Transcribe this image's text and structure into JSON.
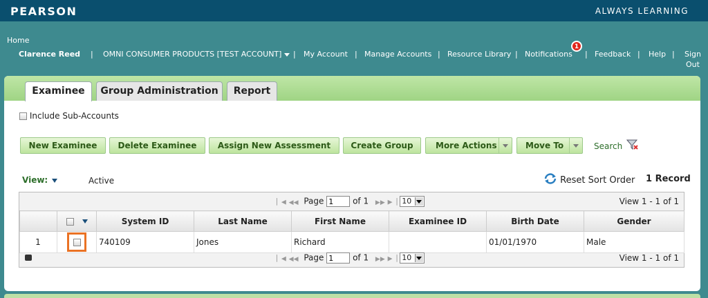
{
  "header": {
    "logo": "PEARSON",
    "tagline": "ALWAYS LEARNING"
  },
  "nav": {
    "home": "Home",
    "user": "Clarence Reed",
    "account": "OMNI CONSUMER PRODUCTS [TEST ACCOUNT]",
    "links": [
      "My Account",
      "Manage Accounts",
      "Resource Library",
      "Notifications",
      "Feedback",
      "Help"
    ],
    "sign_out_1": "Sign",
    "sign_out_2": "Out",
    "notification_count": "1",
    "separator": "|"
  },
  "tabs": [
    "Examinee",
    "Group Administration",
    "Report"
  ],
  "include_sub_accounts": "Include Sub-Accounts",
  "toolbar": {
    "new_examinee": "New Examinee",
    "delete_examinee": "Delete Examinee",
    "assign_new_assessment": "Assign New Assessment",
    "create_group": "Create Group",
    "more_actions": "More Actions",
    "move_to": "Move To",
    "search": "Search"
  },
  "view": {
    "label": "View:",
    "value": "Active",
    "reset_sort": "Reset Sort Order",
    "record_count": "1 Record"
  },
  "pager": {
    "page_label": "Page",
    "page_value": "1",
    "of_label": "of 1",
    "rows_per_page": "10",
    "view_range": "View 1 - 1 of 1"
  },
  "table": {
    "columns": [
      "System ID",
      "Last Name",
      "First Name",
      "Examinee ID",
      "Birth Date",
      "Gender"
    ],
    "rows": [
      {
        "num": "1",
        "system_id": "740109",
        "last_name": "Jones",
        "first_name": "Richard",
        "examinee_id": "",
        "birth_date": "01/01/1970",
        "gender": "Male"
      }
    ]
  },
  "colors": {
    "header_bg": "#0a4f6e",
    "page_bg": "#3e8a8f",
    "button_text": "#2d5a18",
    "highlight": "#ea7224",
    "badge": "#e1251b"
  }
}
